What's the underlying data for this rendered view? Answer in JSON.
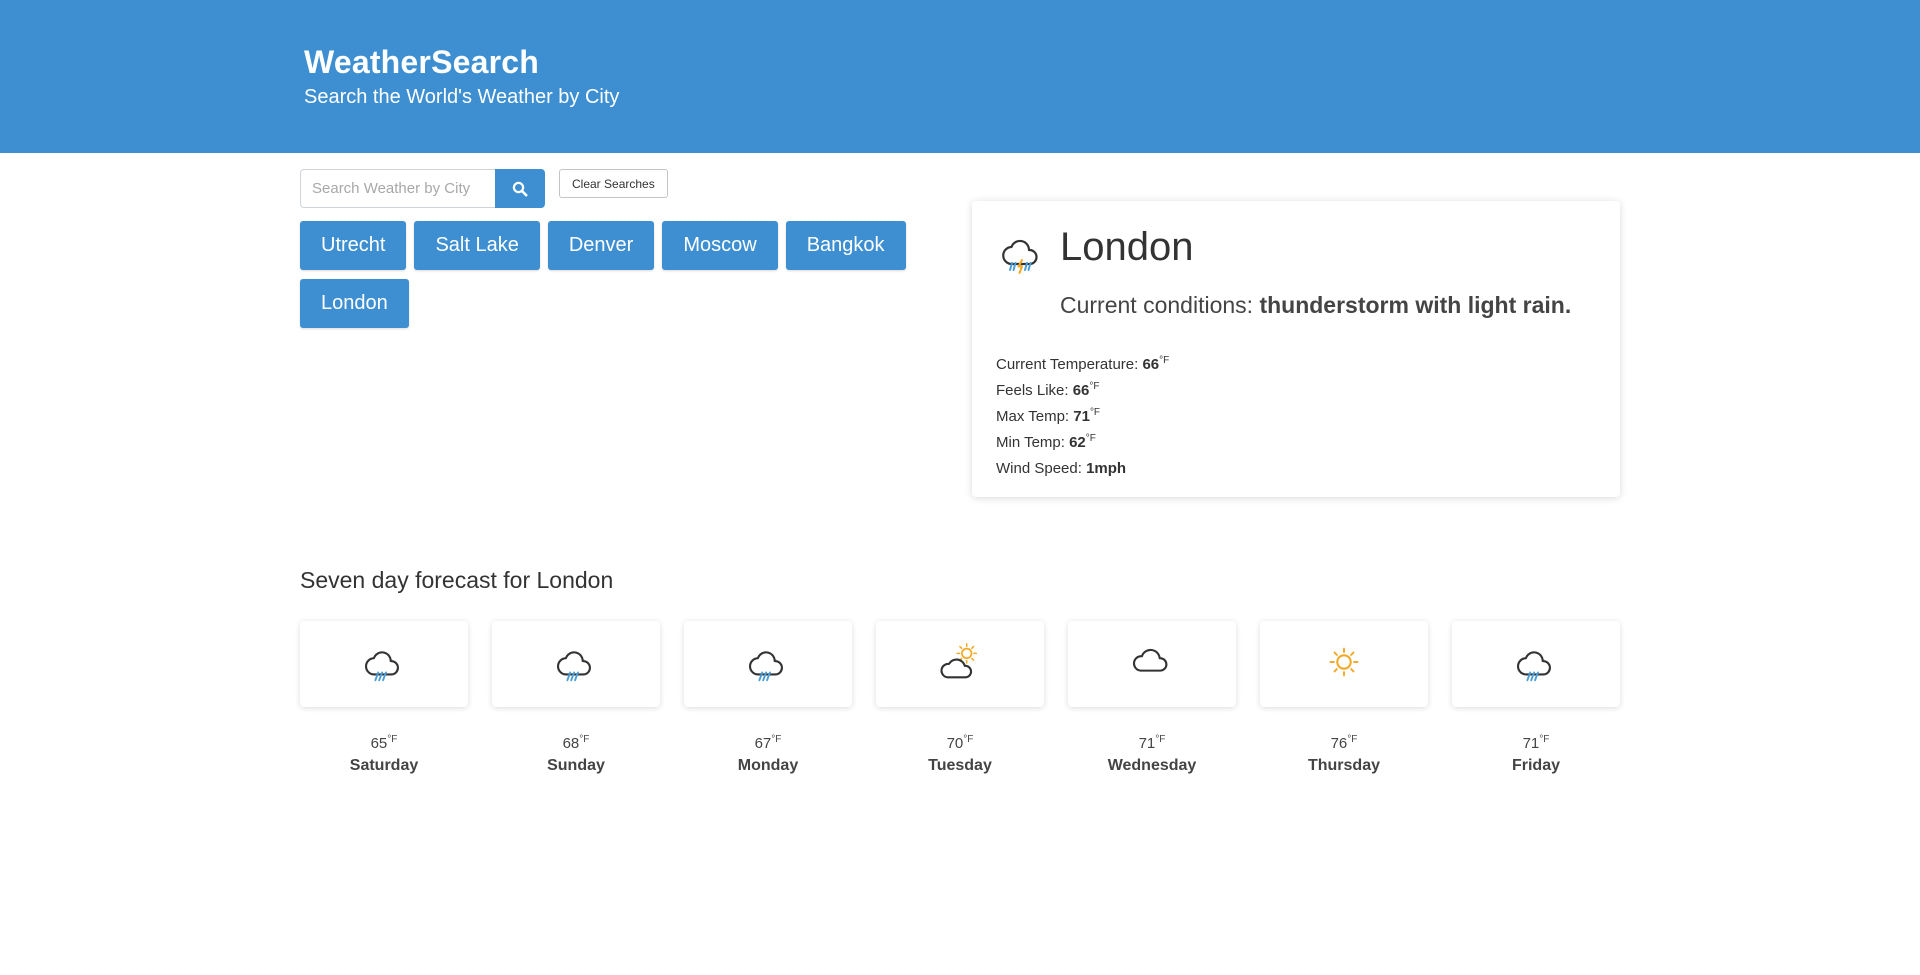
{
  "header": {
    "title": "WeatherSearch",
    "subtitle": "Search the World's Weather by City",
    "background_color": "#3d8fd1"
  },
  "search": {
    "placeholder": "Search Weather by City",
    "value": "",
    "button_icon": "search-icon",
    "clear_label": "Clear Searches"
  },
  "history": [
    {
      "label": "Utrecht"
    },
    {
      "label": "Salt Lake"
    },
    {
      "label": "Denver"
    },
    {
      "label": "Moscow"
    },
    {
      "label": "Bangkok"
    },
    {
      "label": "London"
    }
  ],
  "current": {
    "city": "London",
    "icon": "thunderstorm-rain-icon",
    "conditions_prefix": "Current conditions: ",
    "conditions": "thunderstorm with light rain.",
    "stats": [
      {
        "label": "Current Temperature: ",
        "value": "66",
        "unit": "°F"
      },
      {
        "label": "Feels Like: ",
        "value": "66",
        "unit": "°F"
      },
      {
        "label": "Max Temp: ",
        "value": "71",
        "unit": "°F"
      },
      {
        "label": "Min Temp: ",
        "value": "62",
        "unit": "°F"
      },
      {
        "label": "Wind Speed: ",
        "value": "1mph",
        "unit": ""
      }
    ]
  },
  "forecast": {
    "title": "Seven day forecast for London",
    "days": [
      {
        "day": "Saturday",
        "temp": "65",
        "unit": "°F",
        "icon": "rain-icon"
      },
      {
        "day": "Sunday",
        "temp": "68",
        "unit": "°F",
        "icon": "rain-icon"
      },
      {
        "day": "Monday",
        "temp": "67",
        "unit": "°F",
        "icon": "rain-icon"
      },
      {
        "day": "Tuesday",
        "temp": "70",
        "unit": "°F",
        "icon": "partly-cloudy-icon"
      },
      {
        "day": "Wednesday",
        "temp": "71",
        "unit": "°F",
        "icon": "cloud-icon"
      },
      {
        "day": "Thursday",
        "temp": "76",
        "unit": "°F",
        "icon": "sun-icon"
      },
      {
        "day": "Friday",
        "temp": "71",
        "unit": "°F",
        "icon": "rain-icon"
      }
    ]
  },
  "colors": {
    "accent": "#3d8fd1",
    "rain": "#4a9fd8",
    "sun": "#f2a925",
    "lightning": "#f2a925"
  }
}
